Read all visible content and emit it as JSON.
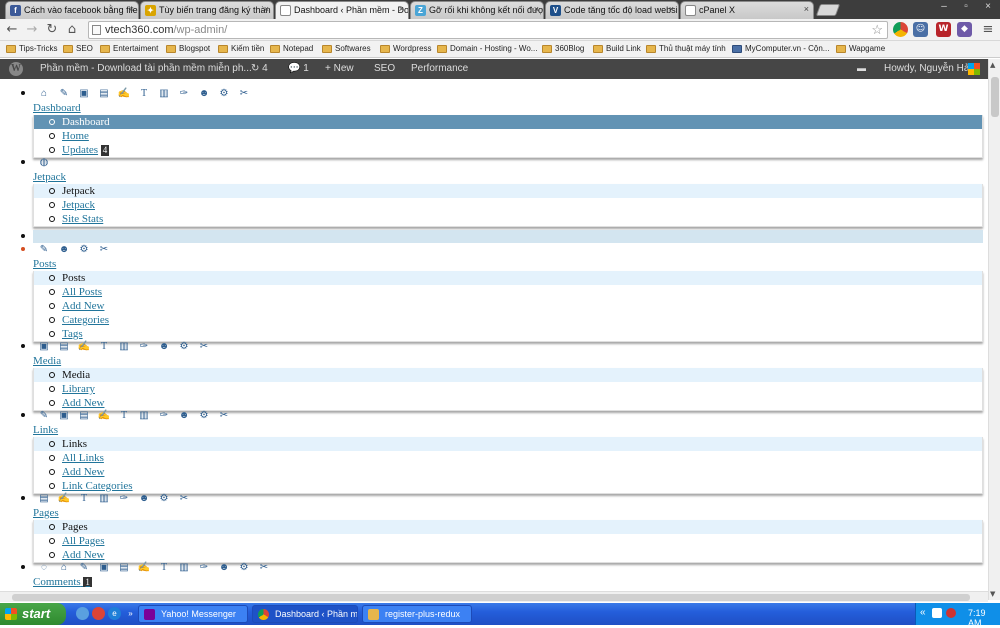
{
  "browser": {
    "tabs": [
      {
        "title": "Cách vào facebook bằng file",
        "icon": "facebook-icon",
        "active": false
      },
      {
        "title": "Tùy biến trang đăng ký thàn",
        "icon": "puzzle-icon",
        "active": false
      },
      {
        "title": "Dashboard ‹ Phần mềm - Dow",
        "icon": "page-icon",
        "active": true
      },
      {
        "title": "Gỡ rối khi không kết nối được",
        "icon": "z-icon",
        "active": false
      },
      {
        "title": "Code tăng tốc độ load websi",
        "icon": "v-icon",
        "active": false
      },
      {
        "title": "cPanel X",
        "icon": "page-icon",
        "active": false
      }
    ],
    "close_glyph": "×",
    "window_controls": [
      "–",
      "▫",
      "×"
    ],
    "url_host": "vtech360.com",
    "url_path": "/wp-admin/",
    "bookmarks": [
      "Tips-Tricks",
      "SEO",
      "Entertaiment",
      "Blogspot",
      "Kiếm tiền",
      "Notepad",
      "Softwares",
      "Wordpress",
      "Domain - Hosting - Wo...",
      "360Blog",
      "Build Link",
      "Thủ thuật máy tính",
      "MyComputer.vn - Cộn...",
      "Wapgame"
    ]
  },
  "adminbar": {
    "site_name": "Phần mềm - Download tài phần mềm miễn ph...",
    "updates_count": "4",
    "comments_count": "1",
    "new_label": "+ New",
    "seo_label": "SEO",
    "performance_label": "Performance",
    "greeting": "Howdy, Nguyễn Hải"
  },
  "menu": {
    "dashboard": {
      "label": "Dashboard",
      "sub_head": "Dashboard",
      "items": [
        "Home",
        "Updates"
      ],
      "updates_badge": "4"
    },
    "jetpack": {
      "label": "Jetpack",
      "sub_head": "Jetpack",
      "items": [
        "Jetpack",
        "Site Stats"
      ]
    },
    "posts": {
      "label": "Posts",
      "sub_head": "Posts",
      "items": [
        "All Posts",
        "Add New",
        "Categories",
        "Tags"
      ]
    },
    "media": {
      "label": "Media",
      "sub_head": "Media",
      "items": [
        "Library",
        "Add New"
      ]
    },
    "links": {
      "label": "Links",
      "sub_head": "Links",
      "items": [
        "All Links",
        "Add New",
        "Link Categories"
      ]
    },
    "pages": {
      "label": "Pages",
      "sub_head": "Pages",
      "items": [
        "All Pages",
        "Add New"
      ]
    },
    "comments": {
      "label": "Comments",
      "badge": "1"
    }
  },
  "taskbar": {
    "start_label": "start",
    "buttons": [
      "Yahoo! Messenger",
      "Dashboard ‹ Phần mề...",
      "register-plus-redux"
    ],
    "clock": "7:19 AM"
  },
  "colors": {
    "admin_accent": "#21759b",
    "admin_bar": "#464646",
    "taskbar": "#245edb"
  }
}
